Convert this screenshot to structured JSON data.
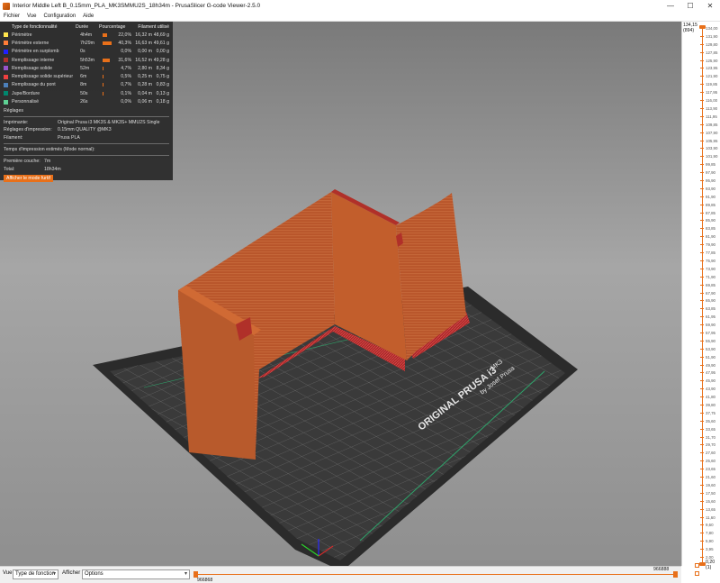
{
  "window": {
    "title": "Interior Middle Left B_0.15mm_PLA_MK3SMMU2S_18h34m - PrusaSlicer G-code Viewer-2.5.0",
    "min": "—",
    "max": "☐",
    "close": "✕"
  },
  "menu": [
    "Fichier",
    "Vue",
    "Configuration",
    "Aide"
  ],
  "legend": {
    "headers": {
      "type": "Type de fonctionnalité",
      "duration": "Durée",
      "percent": "Pourcentage",
      "filament": "Filament utilisé"
    },
    "rows": [
      {
        "name": "Périmètre",
        "color": "#ffe64d",
        "duration": "4h4m",
        "percent": "22,0%",
        "pct_value": 22.0,
        "meters": "16,32 m",
        "grams": "48,69 g"
      },
      {
        "name": "Périmètre externe",
        "color": "#ff7d38",
        "duration": "7h29m",
        "percent": "40,3%",
        "pct_value": 40.3,
        "meters": "16,63 m",
        "grams": "49,61 g"
      },
      {
        "name": "Périmètre en surplomb",
        "color": "#1f1fff",
        "duration": "0s",
        "percent": "0,0%",
        "pct_value": 0.0,
        "meters": "0,00 m",
        "grams": "0,00 g"
      },
      {
        "name": "Remplissage interne",
        "color": "#b03029",
        "duration": "5h53m",
        "percent": "31,6%",
        "pct_value": 31.6,
        "meters": "16,52 m",
        "grams": "49,28 g"
      },
      {
        "name": "Remplissage solide",
        "color": "#9654cc",
        "duration": "52m",
        "percent": "4,7%",
        "pct_value": 4.7,
        "meters": "2,80 m",
        "grams": "8,34 g"
      },
      {
        "name": "Remplissage solide supérieur",
        "color": "#f04040",
        "duration": "6m",
        "percent": "0,5%",
        "pct_value": 0.5,
        "meters": "0,25 m",
        "grams": "0,75 g"
      },
      {
        "name": "Remplissage du pont",
        "color": "#4d80ba",
        "duration": "8m",
        "percent": "0,7%",
        "pct_value": 0.7,
        "meters": "0,28 m",
        "grams": "0,83 g"
      },
      {
        "name": "Jupe/Bordure",
        "color": "#00876e",
        "duration": "50s",
        "percent": "0,1%",
        "pct_value": 0.1,
        "meters": "0,04 m",
        "grams": "0,13 g"
      },
      {
        "name": "Personnalisé",
        "color": "#5ed194",
        "duration": "26s",
        "percent": "0,0%",
        "pct_value": 0.0,
        "meters": "0,06 m",
        "grams": "0,18 g"
      }
    ],
    "reglages": "Réglages",
    "printer_label": "Imprimante:",
    "printer_value": "Original Prusa i3 MK3S & MK3S+ MMU2S Single",
    "print_settings_label": "Réglages d'impression:",
    "print_settings_value": "0.15mm QUALITY @MK3",
    "filament_label": "Filament:",
    "filament_value": "Prusa PLA",
    "estimated_time": "Temps d'impression estimés (Mode normal):",
    "first_layer_label": "Première couche:",
    "first_layer_value": "7m",
    "total_label": "Total:",
    "total_value": "18h34m",
    "stealth_button": "Afficher le mode furtif"
  },
  "bed": {
    "brand_line": "ORIGINAL PRUSA i3",
    "model": "MK3",
    "by_line": "by Josef Prusa"
  },
  "layer_slider": {
    "top_value": "134,15",
    "top_layer": "(894)",
    "bottom_value": "0,20",
    "bottom_layer": "(1)",
    "ticks": [
      "134,00",
      "131,90",
      "129,80",
      "127,85",
      "125,90",
      "123,95",
      "121,90",
      "119,85",
      "117,95",
      "116,00",
      "113,90",
      "111,95",
      "109,85",
      "107,90",
      "105,95",
      "103,90",
      "101,90",
      "99,85",
      "97,90",
      "95,90",
      "93,90",
      "91,90",
      "89,85",
      "87,85",
      "85,90",
      "83,85",
      "81,90",
      "79,90",
      "77,85",
      "75,90",
      "73,90",
      "71,90",
      "69,85",
      "67,90",
      "65,90",
      "63,85",
      "61,95",
      "59,90",
      "57,95",
      "55,90",
      "53,90",
      "51,90",
      "49,90",
      "47,95",
      "45,90",
      "43,90",
      "41,80",
      "39,80",
      "37,75",
      "35,60",
      "33,65",
      "31,70",
      "29,70",
      "27,60",
      "25,60",
      "23,65",
      "21,60",
      "19,60",
      "17,50",
      "15,60",
      "13,65",
      "11,60",
      "9,60",
      "7,80",
      "5,90",
      "3,95",
      "2,00"
    ]
  },
  "bottom": {
    "vue_label": "Vue",
    "vue_select": "Type de fonction",
    "afficher_label": "Afficher",
    "options_select": "Options",
    "move_right": "966888",
    "move_left": "966868"
  }
}
